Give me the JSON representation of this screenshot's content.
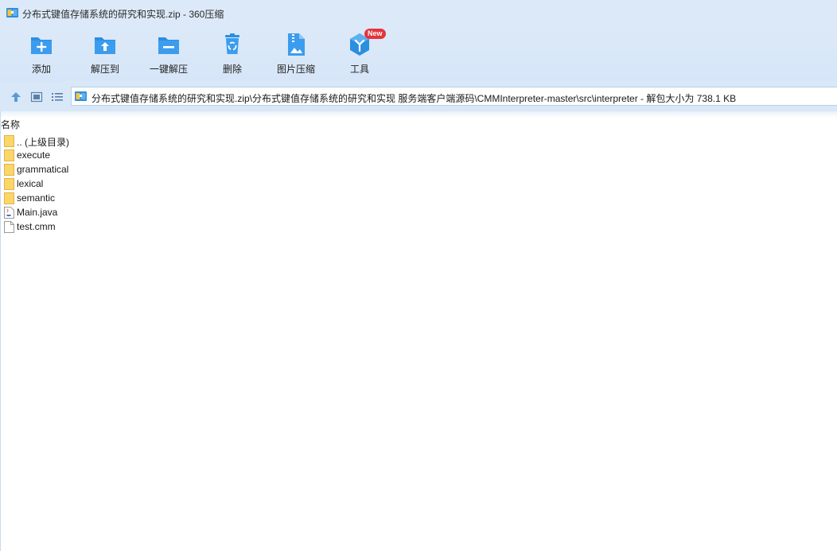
{
  "window": {
    "title": "分布式键值存储系统的研究和实现.zip - 360压缩",
    "logo_icon": "archive-app-icon"
  },
  "toolbar": {
    "items": [
      {
        "label": "添加",
        "icon": "add-folder-icon"
      },
      {
        "label": "解压到",
        "icon": "extract-to-icon"
      },
      {
        "label": "一键解压",
        "icon": "one-click-extract-icon"
      },
      {
        "label": "删除",
        "icon": "recycle-delete-icon"
      },
      {
        "label": "图片压缩",
        "icon": "image-compress-icon"
      },
      {
        "label": "工具",
        "icon": "tools-cube-icon",
        "badge": "New"
      }
    ]
  },
  "nav": {
    "up_icon": "up-arrow-icon",
    "view_icon": "thumbnail-view-icon",
    "list_icon": "list-view-icon",
    "address": "分布式键值存储系统的研究和实现.zip\\分布式键值存储系统的研究和实现 服务端客户端源码\\CMMInterpreter-master\\src\\interpreter - 解包大小为 738.1 KB"
  },
  "list": {
    "column_name": "名称",
    "files": [
      {
        "name": ".. (上级目录)",
        "type": "folder"
      },
      {
        "name": "execute",
        "type": "folder"
      },
      {
        "name": "grammatical",
        "type": "folder"
      },
      {
        "name": "lexical",
        "type": "folder"
      },
      {
        "name": "semantic",
        "type": "folder"
      },
      {
        "name": "Main.java",
        "type": "java"
      },
      {
        "name": "test.cmm",
        "type": "file"
      }
    ]
  },
  "colors": {
    "accent": "#2b8fe0",
    "chrome": "#dce9f8",
    "folder": "#fbd66a",
    "badge": "#e5343c"
  }
}
